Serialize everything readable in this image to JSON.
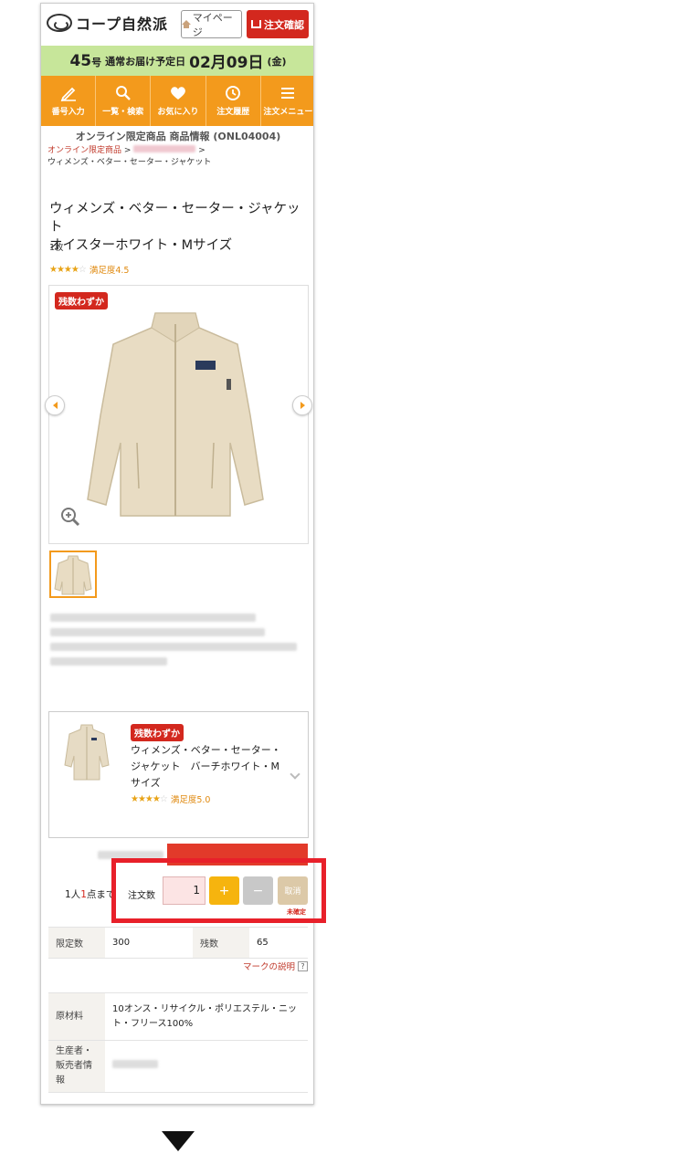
{
  "header": {
    "logo_text": "コープ自然派",
    "mypage_label": "マイページ",
    "confirm_label": "注文確認"
  },
  "delivery": {
    "issue_no": "45",
    "issue_suffix": "号",
    "label": "通常お届け予定日",
    "date": "02月09日",
    "weekday": "(金)"
  },
  "nav": {
    "items": [
      {
        "label": "番号入力",
        "icon": "pencil-icon"
      },
      {
        "label": "一覧・検索",
        "icon": "search-icon"
      },
      {
        "label": "お気に入り",
        "icon": "heart-icon"
      },
      {
        "label": "注文履歴",
        "icon": "clock-icon"
      },
      {
        "label": "注文メニュー",
        "icon": "menu-icon"
      }
    ]
  },
  "product": {
    "info_heading": "オンライン限定商品 商品情報 (ONL04004)",
    "breadcrumb_root": "オンライン限定商品",
    "breadcrumb_sep": ">",
    "breadcrumb_current": "ウィメンズ・ベター・セーター・ジャケット",
    "title_line1": "ウィメンズ・ベター・セーター・ジャケット",
    "title_line2": "オイスターホワイト・Mサイズ",
    "quantity_unit": "1枚",
    "rating_label": "満足度4.5",
    "badge": "残数わずか"
  },
  "related": {
    "badge": "残数わずか",
    "name": "ウィメンズ・ベター・セーター・ジャケット　バーチホワイト・Mサイズ",
    "rating_label": "満足度5.0"
  },
  "order": {
    "limit_prefix": "1人",
    "limit_number": "1",
    "limit_suffix": "点まで",
    "label": "注文数",
    "quantity": "1",
    "plus_label": "+",
    "minus_label": "−",
    "cancel_label": "取消",
    "status": "未確定"
  },
  "spec": {
    "limit_header": "限定数",
    "limit_value": "300",
    "remaining_header": "残数",
    "remaining_value": "65",
    "mark_link": "マークの説明",
    "material_header": "原材料",
    "material_value": "10オンス・リサイクル・ポリエステル・ニット・フリース100%",
    "producer_header": "生産者・販売者情報"
  },
  "colors": {
    "brand_orange": "#f39a1c",
    "brand_red": "#d3281e",
    "delivery_green": "#c7e69a"
  }
}
